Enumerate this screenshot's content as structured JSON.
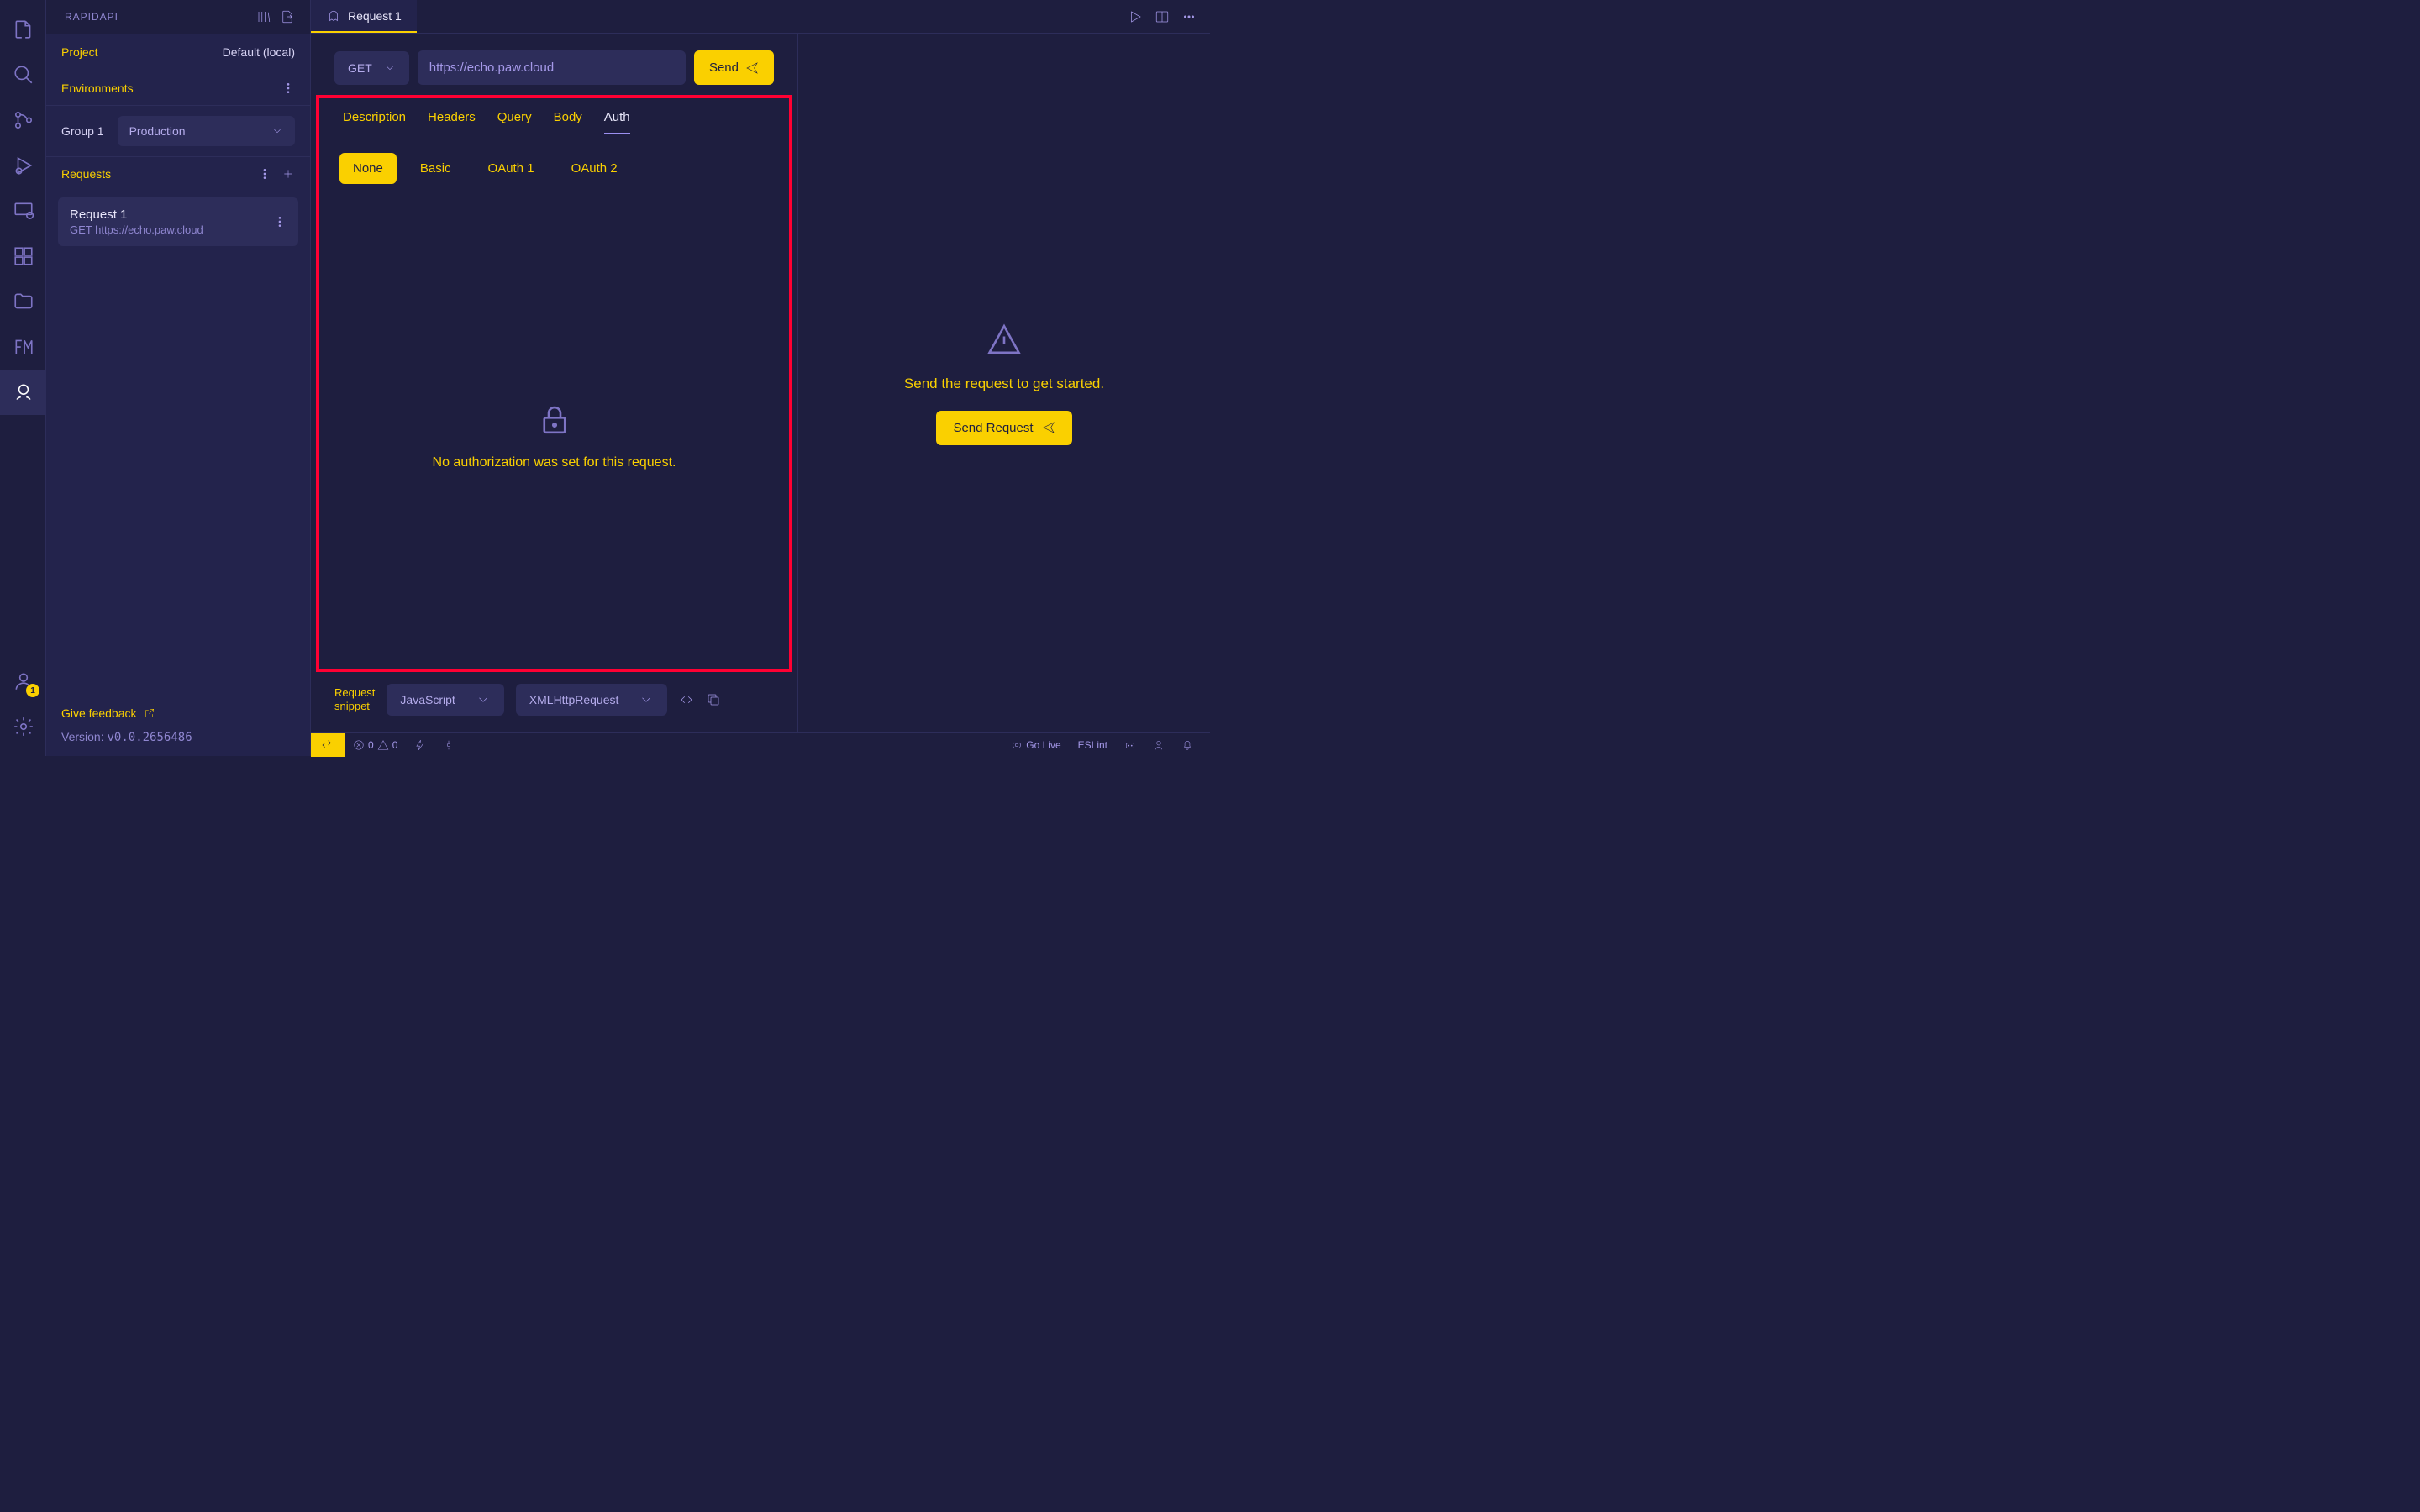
{
  "sidebar": {
    "title": "RAPIDAPI",
    "project_label": "Project",
    "project_value": "Default (local)",
    "environments_label": "Environments",
    "group_label": "Group 1",
    "env_selected": "Production",
    "requests_label": "Requests",
    "request_items": [
      {
        "name": "Request 1",
        "sub": "GET https://echo.paw.cloud"
      }
    ],
    "feedback_label": "Give feedback",
    "version_label": "Version: ",
    "version_value": "v0.0.2656486"
  },
  "tab": {
    "title": "Request 1"
  },
  "request": {
    "method": "GET",
    "url": "https://echo.paw.cloud",
    "send_label": "Send",
    "tabs": {
      "description": "Description",
      "headers": "Headers",
      "query": "Query",
      "body": "Body",
      "auth": "Auth"
    },
    "auth_types": {
      "none": "None",
      "basic": "Basic",
      "oauth1": "OAuth 1",
      "oauth2": "OAuth 2"
    },
    "auth_empty_msg": "No authorization was set for this request."
  },
  "snippet": {
    "label1": "Request",
    "label2": "snippet",
    "lang": "JavaScript",
    "lib": "XMLHttpRequest"
  },
  "response": {
    "msg": "Send the request to get started.",
    "button": "Send Request"
  },
  "statusbar": {
    "errors": "0",
    "warnings": "0",
    "golive": "Go Live",
    "eslint": "ESLint"
  },
  "activity_badge": "1"
}
